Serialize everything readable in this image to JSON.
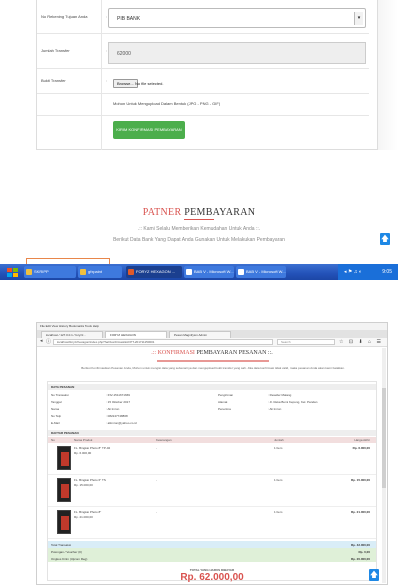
{
  "form": {
    "bank_label": "No Rekening Tujuan Anda",
    "bank_value": "PIB BANK",
    "amount_label": "Jumlah Transfer",
    "amount_value": "62000",
    "proof_label": "Bukti Transfer",
    "file_button": "Browse...",
    "file_status": "No file selected.",
    "upload_hint": "Mohon Untuk Mengupload Dalam Bentuk (JPG - PNG - GIF)",
    "confirm_button": "KIRIM KONFIRMASI PEMBAYARAN",
    "colon": ":"
  },
  "partner": {
    "title_red": "PATNER",
    "title_dark": "PEMBAYARAN",
    "subtitle": ".:: Kami Selalu Memberikan Kemudahan Untuk Anda ::.",
    "note": "Berikut Data Bank Yang Dapat Anda Gunakan Untuk Melakukan Pembayaran"
  },
  "taskbar": {
    "items": [
      {
        "label": "SKRIPP",
        "color": "#f0c040"
      },
      {
        "label": "gfxpaint",
        "color": "#f0c040"
      },
      {
        "label": "FORYZ HEXAGON ...",
        "color": "#e05a2a"
      },
      {
        "label": "BAB V - Microsoft W...",
        "color": "#2b5cc4"
      },
      {
        "label": "BAB V - Microsoft W...",
        "color": "#2b5cc4"
      }
    ],
    "tray_icons": "◂ ⚑ ♫ ◐",
    "clock": "9:05"
  },
  "browser": {
    "menu": "File  Edit  View  History  Bookmarks  Tools  Help",
    "tabs": [
      "localhost / 127.0.0.1 / foryzz...",
      "FORYZ HEXAGON",
      "Pesan Magnifysm Admin"
    ],
    "url": "localhost/foryzzhexagon/index.php?hal=konfirmasi&id=PT-201711150001",
    "search_placeholder": "Search",
    "tool_icons": "☆ ⊡ ⬇ ⌂ ☰"
  },
  "invoice": {
    "heading_red": ".:: KONFIRMASI",
    "heading_dark": "PEMBAYARAN PESANAN ::.",
    "intro": "Berikut Konfirmasikan Pesanan Anda, Mohon untuk mengisi data yang sebenarnya dan mengupload bukti transfer yang sah. Jika data konfirmasi tidak valid, maka pesanan Anda akan kami batalkan.",
    "info_section": "DATA PESANAN",
    "info_left": [
      {
        "k": "No Transaksi",
        "v": ": INV-1511671669"
      },
      {
        "k": "Tanggal",
        "v": ": 15 Oktober 2017"
      },
      {
        "k": "Nama",
        "v": ": Ali Imron"
      },
      {
        "k": "No Telp",
        "v": ": 082247748868"
      },
      {
        "k": "E-Mail",
        "v": ": aliimron@yahoo.co.id"
      }
    ],
    "info_right": [
      {
        "k": "Pengiriman",
        "v": ": Reseller Malang"
      },
      {
        "k": "Alamat",
        "v": ": Jl. Reka Bumi Kepung, Kel. Pandan"
      },
      {
        "k": "Penerima",
        "v": ": Ali Imron"
      }
    ],
    "items_section": "DAFTAR PESANAN",
    "cols": [
      "No",
      "Nama Produk",
      "Keterangan",
      "Jumlah",
      "Harga Akhir"
    ],
    "items": [
      {
        "name": "FL. Bingkai Photo 8\" TP-02",
        "price": "Rp. 6.000,00",
        "mid": "-",
        "qty": "1 Item",
        "total": "Rp. 6.000,00"
      },
      {
        "name": "FL. Bingkai Photo 6\" TS",
        "price": "Rp. 15.000,00",
        "mid": "-",
        "qty": "1 Item",
        "total": "Rp. 15.000,00"
      },
      {
        "name": "FL. Bingkai Photo 8\"",
        "price": "Rp. 21.000,00",
        "mid": "-",
        "qty": "1 Item",
        "total": "Rp. 21.000,00"
      }
    ],
    "sum_rows": [
      {
        "label": "Total Transaksi",
        "value": "Rp. 42.000,00",
        "bg": "#d9edf7"
      },
      {
        "label": "Potongan / Voucher (0)",
        "value": "Rp. 0,00",
        "bg": "#dff0d8"
      },
      {
        "label": "Ongkos Kirim (Ujicom Reg)",
        "value": "Rp. 20.000,00",
        "bg": "#dff0d8"
      }
    ],
    "grand_label": "TOTAL YANG HARUS DIBAYAR",
    "grand_value": "Rp. 62.000,00"
  },
  "icons": {
    "up_arrow": "🡅"
  }
}
